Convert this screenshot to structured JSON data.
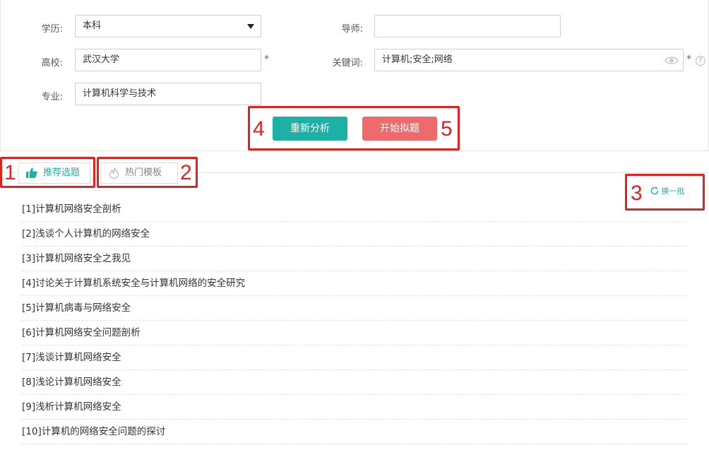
{
  "form": {
    "education_label": "学历:",
    "education_value": "本科",
    "advisor_label": "导师:",
    "advisor_value": "",
    "school_label": "高校:",
    "school_value": "武汉大学",
    "keywords_label": "关键词:",
    "keywords_value": "计算机;安全;网络",
    "major_label": "专业:",
    "major_value": "计算机科学与技术",
    "required_mark": "*",
    "help_mark": "?"
  },
  "actions": {
    "analyze_label": "重新分析",
    "start_label": "开始拟题"
  },
  "tabs": {
    "recommended_label": "推荐选题",
    "hot_label": "热门模板"
  },
  "refresh_label": "换一批",
  "annotations": [
    "1",
    "2",
    "3",
    "4",
    "5"
  ],
  "topics": [
    "[1]计算机网络安全剖析",
    "[2]浅谈个人计算机的网络安全",
    "[3]计算机网络安全之我见",
    "[4]讨论关于计算机系统安全与计算机网络的安全研究",
    "[5]计算机病毒与网络安全",
    "[6]计算机网络安全问题剖析",
    "[7]浅谈计算机网络安全",
    "[8]浅论计算机网络安全",
    "[9]浅析计算机网络安全",
    "[10]计算机的网络安全问题的探讨"
  ],
  "colors": {
    "accent": "#1db1a6",
    "start_button": "#ef6b6b",
    "annotation": "#e0231c",
    "required": "#e4393c"
  },
  "icons": {
    "thumbs_up": "thumbs-up-icon",
    "fire": "fire-icon",
    "refresh": "refresh-icon",
    "eye": "eye-icon",
    "caret": "caret-down-icon",
    "help": "help-icon"
  }
}
